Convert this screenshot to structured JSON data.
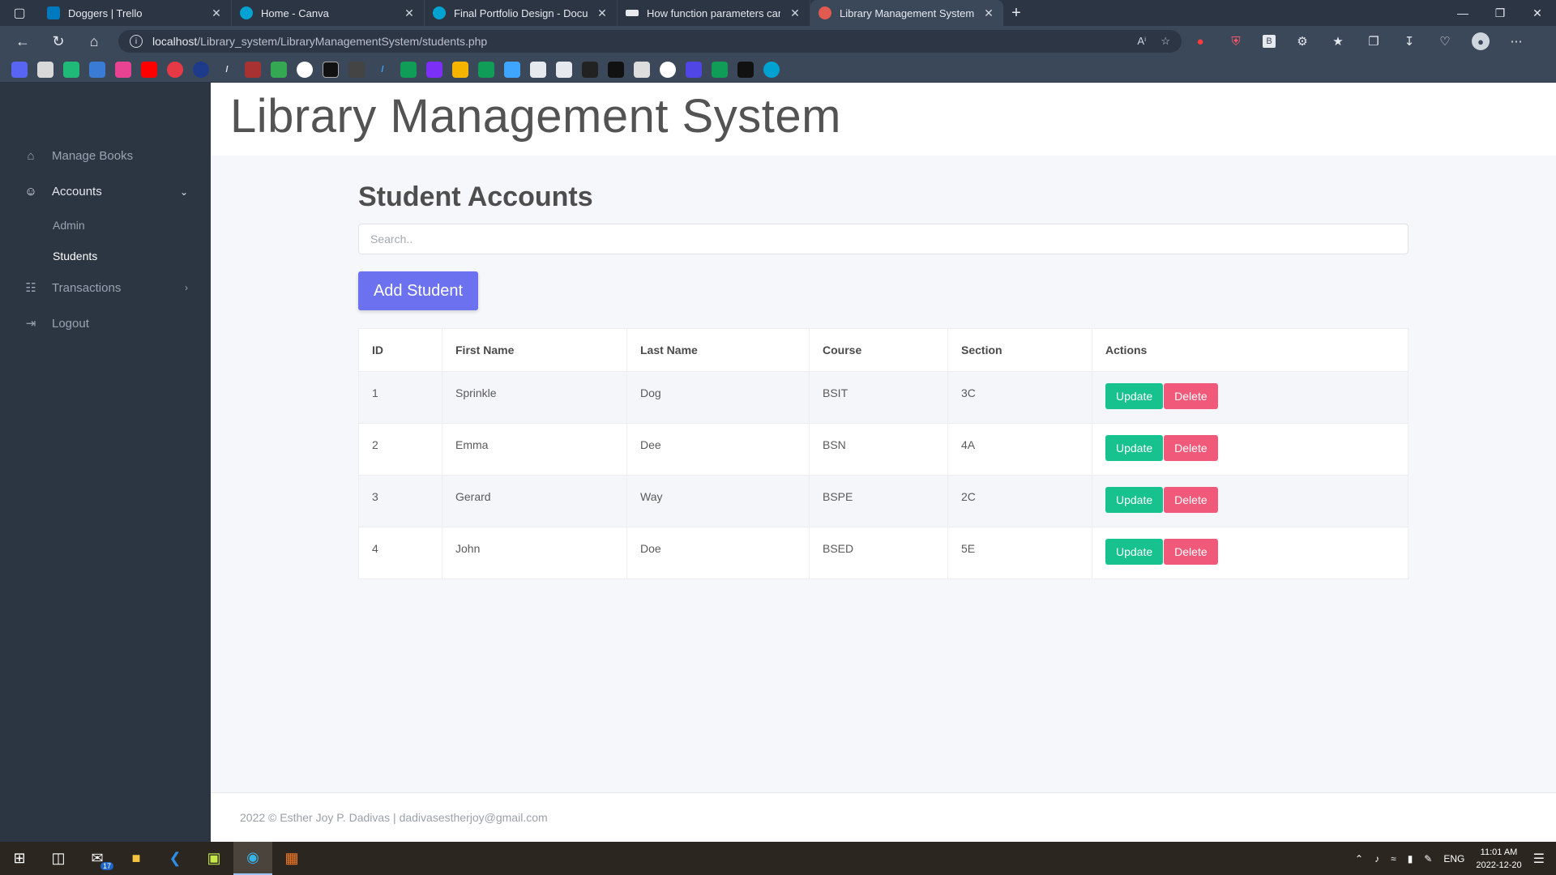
{
  "browser": {
    "tabs": [
      {
        "title": "Doggers | Trello",
        "color": "#0079bf"
      },
      {
        "title": "Home - Canva",
        "color": "#00c4cc"
      },
      {
        "title": "Final Portfolio Design - Documen",
        "color": "#00c4cc"
      },
      {
        "title": "How function parameters can im",
        "color": "#333333"
      },
      {
        "title": "Library Management System",
        "color": "#e05a4f"
      }
    ],
    "url_host": "localhost",
    "url_path": "/Library_system/LibraryManagementSystem/students.php"
  },
  "sidebar": {
    "manage_books": "Manage Books",
    "accounts": "Accounts",
    "admin": "Admin",
    "students": "Students",
    "transactions": "Transactions",
    "logout": "Logout"
  },
  "header": {
    "title": "Library Management System"
  },
  "main": {
    "heading": "Student Accounts",
    "search_placeholder": "Search..",
    "add_button": "Add Student",
    "columns": [
      "ID",
      "First Name",
      "Last Name",
      "Course",
      "Section",
      "Actions"
    ],
    "rows": [
      {
        "id": "1",
        "first": "Sprinkle",
        "last": "Dog",
        "course": "BSIT",
        "section": "3C"
      },
      {
        "id": "2",
        "first": "Emma",
        "last": "Dee",
        "course": "BSN",
        "section": "4A"
      },
      {
        "id": "3",
        "first": "Gerard",
        "last": "Way",
        "course": "BSPE",
        "section": "2C"
      },
      {
        "id": "4",
        "first": "John",
        "last": "Doe",
        "course": "BSED",
        "section": "5E"
      }
    ],
    "update_label": "Update",
    "delete_label": "Delete"
  },
  "footer": {
    "text": "2022 © Esther Joy P. Dadivas | dadivasestherjoy@gmail.com"
  },
  "taskbar": {
    "mail_badge": "17",
    "lang": "ENG",
    "time": "11:01 AM",
    "date": "2022-12-20"
  },
  "colors": {
    "accent": "#6c72ef",
    "update": "#18c28f",
    "delete": "#f0597a",
    "sidebar": "#2c3542"
  }
}
